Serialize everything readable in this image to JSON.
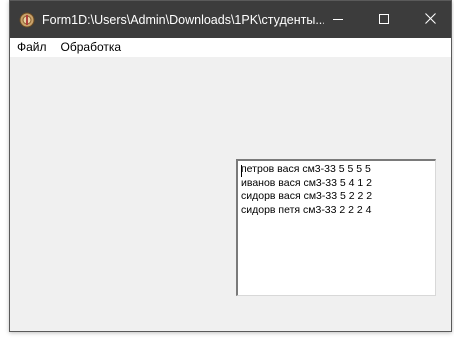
{
  "window": {
    "title": "Form1D:\\Users\\Admin\\Downloads\\1PK\\студенты...",
    "icon": "delphi-app-icon",
    "controls": [
      "minimize-icon",
      "maximize-icon",
      "close-icon"
    ]
  },
  "menubar": {
    "items": [
      {
        "label": "Файл"
      },
      {
        "label": "Обработка"
      }
    ]
  },
  "memo": {
    "lines": [
      "петров вася см3-33 5 5 5 5",
      "иванов вася см3-33 5 4 1 2",
      "сидорв вася см3-33 5 2 2 2",
      "сидорв петя см3-33 2 2 2 4"
    ]
  },
  "colors": {
    "titlebar": "#3c3c3c",
    "client": "#f0f0f0",
    "menubar": "#ffffff"
  }
}
